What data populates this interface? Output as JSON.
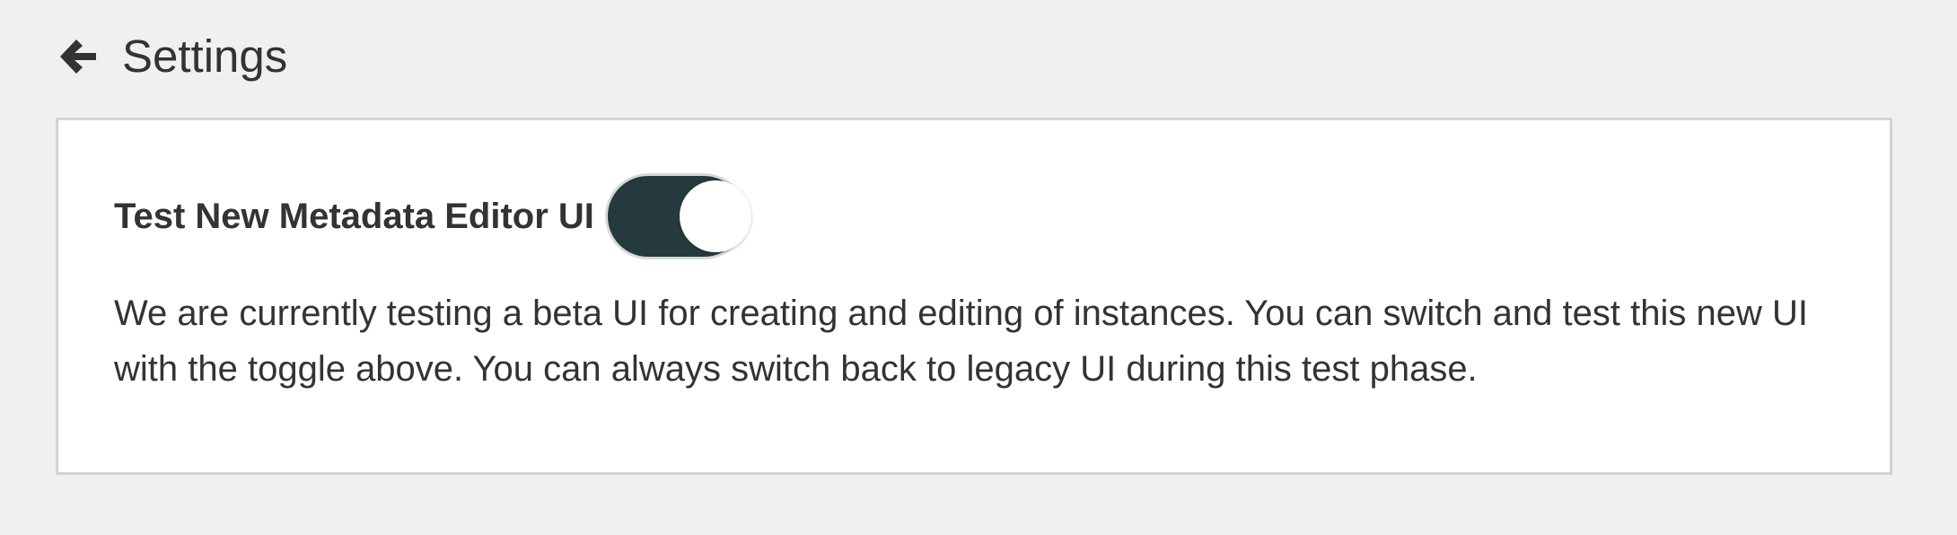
{
  "header": {
    "back_icon": "arrow-left-icon",
    "title": "Settings"
  },
  "setting": {
    "label": "Test New Metadata Editor UI",
    "toggle_on": true,
    "toggle_color": "#253a3c",
    "description": "We are currently testing a beta UI for creating and editing of instances. You can switch and test this new UI with the toggle above. You can always switch back to legacy UI during this test phase."
  }
}
